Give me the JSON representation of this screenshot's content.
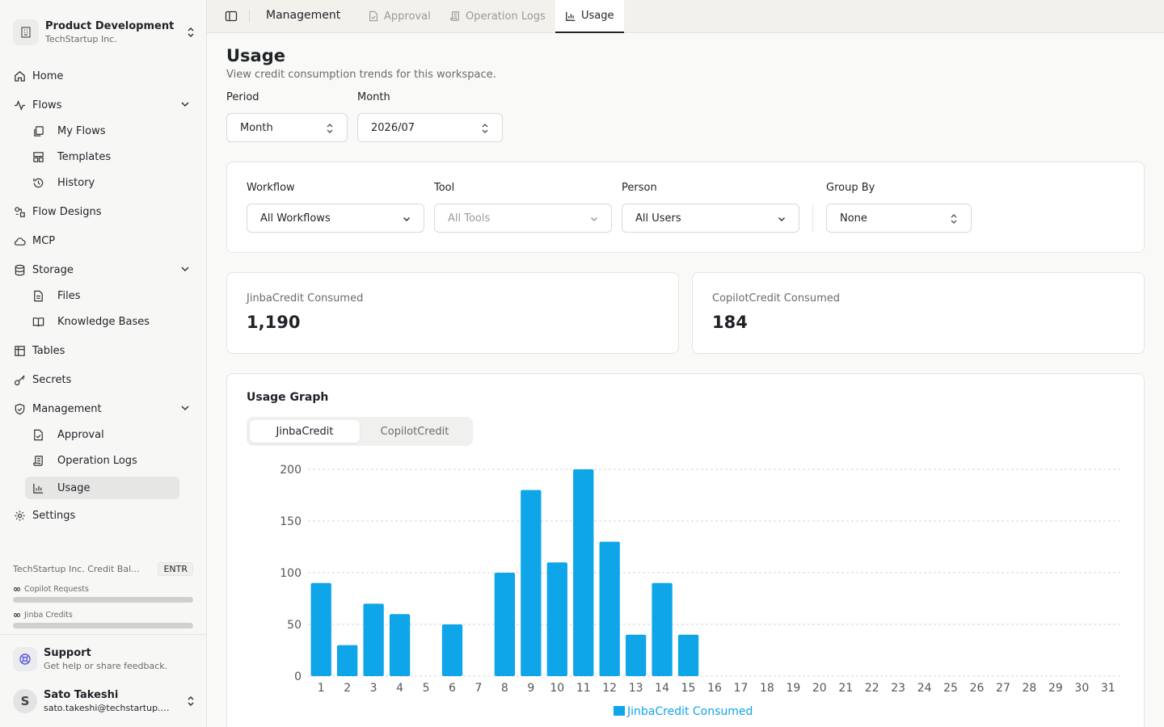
{
  "workspace": {
    "name": "Product Development",
    "org": "TechStartup Inc."
  },
  "nav": {
    "home": "Home",
    "flows": "Flows",
    "my_flows": "My Flows",
    "templates": "Templates",
    "history": "History",
    "flow_designs": "Flow Designs",
    "mcp": "MCP",
    "storage": "Storage",
    "files": "Files",
    "knowledge_bases": "Knowledge Bases",
    "tables": "Tables",
    "secrets": "Secrets",
    "management": "Management",
    "approval": "Approval",
    "operation_logs": "Operation Logs",
    "usage": "Usage",
    "settings": "Settings"
  },
  "credits": {
    "title": "TechStartup Inc. Credit Bal...",
    "badge": "ENTR",
    "copilot_label": "Copilot Requests",
    "jinba_label": "Jinba Credits",
    "infinity": "∞"
  },
  "support": {
    "title": "Support",
    "subtitle": "Get help or share feedback."
  },
  "user": {
    "initial": "S",
    "name": "Sato Takeshi",
    "email": "sato.takeshi@techstartup.com"
  },
  "topbar": {
    "title": "Management",
    "tabs": {
      "approval": "Approval",
      "operation_logs": "Operation Logs",
      "usage": "Usage"
    }
  },
  "page": {
    "title": "Usage",
    "subtitle": "View credit consumption trends for this workspace."
  },
  "filters": {
    "period_label": "Period",
    "period_value": "Month",
    "month_label": "Month",
    "month_value": "2026/07",
    "workflow_label": "Workflow",
    "workflow_value": "All Workflows",
    "tool_label": "Tool",
    "tool_value": "All Tools",
    "person_label": "Person",
    "person_value": "All Users",
    "group_label": "Group By",
    "group_value": "None"
  },
  "stats": {
    "jinba_label": "JinbaCredit Consumed",
    "jinba_value": "1,190",
    "copilot_label": "CopilotCredit Consumed",
    "copilot_value": "184"
  },
  "graph": {
    "title": "Usage Graph",
    "tabs": {
      "jinba": "JinbaCredit",
      "copilot": "CopilotCredit"
    }
  },
  "colors": {
    "bar": "#0ea5e9",
    "grid": "#d4d4d4",
    "axis": "#555555"
  },
  "chart_data": {
    "type": "bar",
    "categories": [
      "1",
      "2",
      "3",
      "4",
      "5",
      "6",
      "7",
      "8",
      "9",
      "10",
      "11",
      "12",
      "13",
      "14",
      "15",
      "16",
      "17",
      "18",
      "19",
      "20",
      "21",
      "22",
      "23",
      "24",
      "25",
      "26",
      "27",
      "28",
      "29",
      "30",
      "31"
    ],
    "series": [
      {
        "name": "JinbaCredit Consumed",
        "values": [
          90,
          30,
          70,
          60,
          0,
          50,
          0,
          100,
          180,
          110,
          200,
          130,
          40,
          90,
          40,
          0,
          0,
          0,
          0,
          0,
          0,
          0,
          0,
          0,
          0,
          0,
          0,
          0,
          0,
          0,
          0
        ]
      }
    ],
    "yticks": [
      0,
      50,
      100,
      150,
      200
    ],
    "ylim": [
      0,
      200
    ],
    "grid": true,
    "legend": "bottom"
  }
}
